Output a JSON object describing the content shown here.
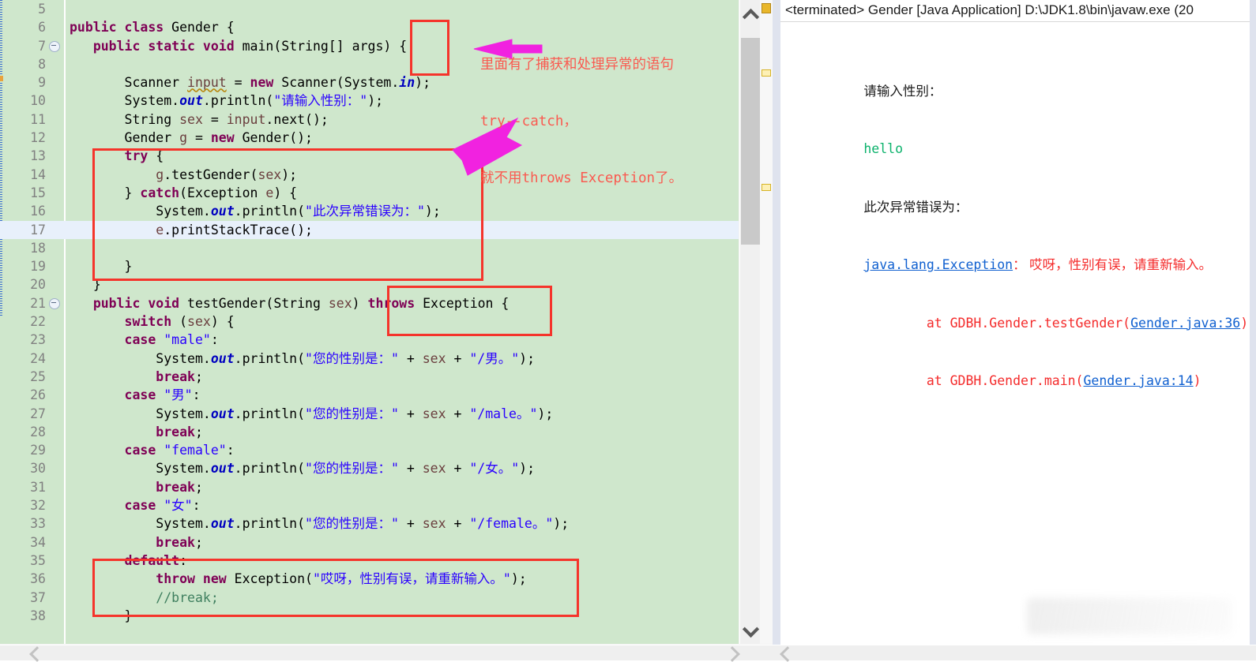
{
  "editor": {
    "first_line_number": 5,
    "highlighted_line": 17,
    "fold_lines": [
      7,
      21
    ],
    "lines": [
      {
        "n": 5,
        "text": ""
      },
      {
        "n": 6,
        "text": "public class Gender {"
      },
      {
        "n": 7,
        "text": "    public static void main(String[] args) {"
      },
      {
        "n": 8,
        "text": ""
      },
      {
        "n": 9,
        "text": "        Scanner input = new Scanner(System.in);"
      },
      {
        "n": 10,
        "text": "        System.out.println(\"请输入性别：\");"
      },
      {
        "n": 11,
        "text": "        String sex = input.next();"
      },
      {
        "n": 12,
        "text": "        Gender g = new Gender();"
      },
      {
        "n": 13,
        "text": "        try {"
      },
      {
        "n": 14,
        "text": "            g.testGender(sex);"
      },
      {
        "n": 15,
        "text": "        } catch(Exception e) {"
      },
      {
        "n": 16,
        "text": "            System.out.println(\"此次异常错误为：\");"
      },
      {
        "n": 17,
        "text": "            e.printStackTrace();"
      },
      {
        "n": 18,
        "text": ""
      },
      {
        "n": 19,
        "text": "        }"
      },
      {
        "n": 20,
        "text": "    }"
      },
      {
        "n": 21,
        "text": "    public void testGender(String sex) throws Exception {"
      },
      {
        "n": 22,
        "text": "        switch (sex) {"
      },
      {
        "n": 23,
        "text": "        case \"male\":"
      },
      {
        "n": 24,
        "text": "            System.out.println(\"您的性别是：\" + sex + \"/男。\");"
      },
      {
        "n": 25,
        "text": "            break;"
      },
      {
        "n": 26,
        "text": "        case \"男\":"
      },
      {
        "n": 27,
        "text": "            System.out.println(\"您的性别是：\" + sex + \"/male。\");"
      },
      {
        "n": 28,
        "text": "            break;"
      },
      {
        "n": 29,
        "text": "        case \"female\":"
      },
      {
        "n": 30,
        "text": "            System.out.println(\"您的性别是：\" + sex + \"/女。\");"
      },
      {
        "n": 31,
        "text": "            break;"
      },
      {
        "n": 32,
        "text": "        case \"女\":"
      },
      {
        "n": 33,
        "text": "            System.out.println(\"您的性别是：\" + sex + \"/female。\");"
      },
      {
        "n": 34,
        "text": "            break;"
      },
      {
        "n": 35,
        "text": "        default:"
      },
      {
        "n": 36,
        "text": "            throw new Exception(\"哎呀，性别有误，请重新输入。\");"
      },
      {
        "n": 37,
        "text": "            //break;"
      },
      {
        "n": 38,
        "text": "        }"
      }
    ]
  },
  "annotation": {
    "line1": "里面有了捕获和处理异常的语句",
    "line2": "try--catch，",
    "line3": "就不用throws Exception了。",
    "color": "#fa5a50",
    "arrow_color": "#f122e0"
  },
  "boxes": {
    "color": "#f5342b",
    "items": [
      {
        "name": "main-closing-brace",
        "label": ") {"
      },
      {
        "name": "try-catch-block",
        "label": "try { ... } catch(Exception e) { ... }"
      },
      {
        "name": "throws-exception",
        "label": "throws Exception"
      },
      {
        "name": "default-throw-block",
        "label": "default: throw new Exception(...)"
      }
    ]
  },
  "console": {
    "title": "<terminated> Gender [Java Application] D:\\JDK1.8\\bin\\javaw.exe (20",
    "lines": [
      {
        "kind": "plain-cn",
        "text": "请输入性别："
      },
      {
        "kind": "input",
        "text": "hello"
      },
      {
        "kind": "plain-cn",
        "text": "此次异常错误为："
      },
      {
        "kind": "exception",
        "link": "java.lang.Exception",
        "rest": "： 哎呀，性别有误，请重新输入。"
      },
      {
        "kind": "stack",
        "prefix": "        at GDBH.Gender.testGender(",
        "link": "Gender.java:36",
        "suffix": ")"
      },
      {
        "kind": "stack",
        "prefix": "        at GDBH.Gender.main(",
        "link": "Gender.java:14",
        "suffix": ")"
      }
    ],
    "colors": {
      "input": "#0cb26c",
      "error": "#f42b2b",
      "link": "#1060d0",
      "text": "#1a1a1a"
    }
  },
  "scrollbars": {
    "editor_vertical": {
      "up_icon": "chevron-up-icon",
      "down_icon": "chevron-down-icon"
    },
    "overview_markers": [
      {
        "type": "error",
        "color": "#e9b72b"
      },
      {
        "type": "warning",
        "color": "#fdf0b5"
      },
      {
        "type": "warning",
        "color": "#fdf0b5"
      }
    ]
  },
  "theme": {
    "code_background": "#cfe7cc",
    "highlight_line": "#e8f0fb",
    "keyword": "#7f0055",
    "string": "#2a00ff",
    "comment": "#3f7f5f",
    "field": "#0000c0",
    "local_var": "#6a3e3e",
    "line_number": "#808080"
  }
}
